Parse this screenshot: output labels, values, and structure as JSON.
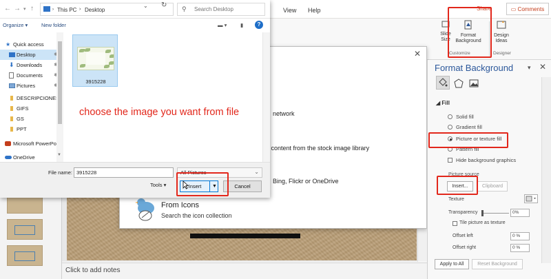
{
  "powerpoint": {
    "menu": [
      "View",
      "Help"
    ],
    "share_label": "Share",
    "comments_label": "Comments",
    "ribbon": {
      "slide_size_label": "Slide Size",
      "format_background_label": "Format Background",
      "design_ideas_label": "Design Ideas",
      "group_customize": "Customize",
      "group_designer": "Designer"
    },
    "insert_pictures_dialog": {
      "options": [
        "network",
        "n content from the stock image library",
        "Bing, Flickr or OneDrive"
      ],
      "from_icons_title": "From Icons",
      "from_icons_subtitle": "Search the icon collection"
    },
    "notes_placeholder": "Click to add notes",
    "format_background": {
      "title": "Format Background",
      "fill_heading": "Fill",
      "fill_options": [
        "Solid fill",
        "Gradient fill",
        "Picture or texture fill",
        "Pattern fill"
      ],
      "selected_fill": "Picture or texture fill",
      "hide_background_graphics": "Hide background graphics",
      "picture_source_label": "Picture source",
      "insert_label": "Insert...",
      "clipboard_label": "Clipboard",
      "texture_label": "Texture",
      "transparency_label": "Transparency",
      "transparency_value": "0%",
      "tile_label": "Tile picture as texture",
      "offset_left_label": "Offset left",
      "offset_left_value": "0 %",
      "offset_right_label": "Offset right",
      "offset_right_value": "0 %",
      "apply_all_label": "Apply to All",
      "reset_label": "Reset Background"
    }
  },
  "explorer": {
    "breadcrumb": [
      "This PC",
      "Desktop"
    ],
    "search_placeholder": "Search Desktop",
    "toolbar": {
      "organize": "Organize ▾",
      "new_folder": "New folder"
    },
    "nav_items": [
      {
        "label": "Quick access",
        "icon": "star-icon",
        "pinned": false,
        "selected": false
      },
      {
        "label": "Desktop",
        "icon": "desktop-icon",
        "pinned": true,
        "selected": true
      },
      {
        "label": "Downloads",
        "icon": "download-icon",
        "pinned": true,
        "selected": false
      },
      {
        "label": "Documents",
        "icon": "document-icon",
        "pinned": true,
        "selected": false
      },
      {
        "label": "Pictures",
        "icon": "pictures-icon",
        "pinned": true,
        "selected": false
      },
      {
        "label": "DESCRIPCIONES",
        "icon": "folder-icon",
        "pinned": false,
        "selected": false
      },
      {
        "label": "GIFS",
        "icon": "folder-icon",
        "pinned": false,
        "selected": false
      },
      {
        "label": "GS",
        "icon": "folder-icon",
        "pinned": false,
        "selected": false
      },
      {
        "label": "PPT",
        "icon": "folder-icon",
        "pinned": false,
        "selected": false
      },
      {
        "label": "Microsoft PowerPo",
        "icon": "powerpoint-icon",
        "pinned": false,
        "selected": false
      },
      {
        "label": "OneDrive",
        "icon": "cloud-icon",
        "pinned": false,
        "selected": false
      }
    ],
    "file": {
      "name": "3915228"
    },
    "annotation": "choose the image you want from file",
    "filename_label": "File name:",
    "filename_value": "3915228",
    "file_type": "All Pictures",
    "tools_label": "Tools ▾",
    "insert_label": "Insert",
    "cancel_label": "Cancel"
  },
  "colors": {
    "annotation_red": "#e2271b",
    "accent_blue": "#0078d7",
    "pane_title_blue": "#2b579a",
    "selection_blue": "#cce4f7"
  }
}
